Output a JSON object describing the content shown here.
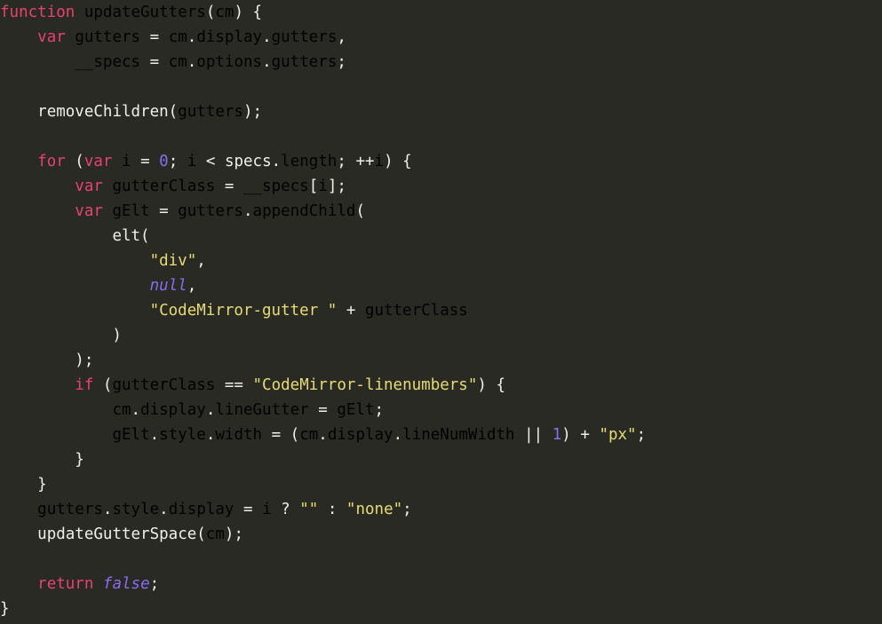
{
  "editor": {
    "background_color": "#2a2a24",
    "language": "javascript",
    "font_size_px": 17.5,
    "line_height_px": 28,
    "colors": {
      "keyword": "#e6436d",
      "definition": "#e8932a",
      "variable": "#79e0d8",
      "property": "#8cc63f",
      "string": "#e6db74",
      "atom": "#8a6cf0",
      "number": "#8a6cf0",
      "plain": "#f0f0e8"
    },
    "code_text": "function updateGutters(cm) {\n    var gutters = cm.display.gutters,\n        __specs = cm.options.gutters;\n\n    removeChildren(gutters);\n\n    for (var i = 0; i < specs.length; ++i) {\n        var gutterClass = __specs[i];\n        var gElt = gutters.appendChild(\n            elt(\n                \"div\",\n                null,\n                \"CodeMirror-gutter \" + gutterClass\n            )\n        );\n        if (gutterClass == \"CodeMirror-linenumbers\") {\n            cm.display.lineGutter = gElt;\n            gElt.style.width = (cm.display.lineNumWidth || 1) + \"px\";\n        }\n    }\n    gutters.style.display = i ? \"\" : \"none\";\n    updateGutterSpace(cm);\n\n    return false;\n}",
    "lines": [
      {
        "n": 1,
        "tokens": [
          {
            "t": "function",
            "c": "keyword"
          },
          {
            "t": " ",
            "c": "plain"
          },
          {
            "t": "updateGutters",
            "c": "definition"
          },
          {
            "t": "(",
            "c": "plain"
          },
          {
            "t": "cm",
            "c": "variable"
          },
          {
            "t": ") {",
            "c": "plain"
          }
        ]
      },
      {
        "n": 2,
        "tokens": [
          {
            "t": "    ",
            "c": "plain"
          },
          {
            "t": "var",
            "c": "keyword"
          },
          {
            "t": " ",
            "c": "plain"
          },
          {
            "t": "gutters",
            "c": "definition"
          },
          {
            "t": " = ",
            "c": "plain"
          },
          {
            "t": "cm",
            "c": "variable"
          },
          {
            "t": ".",
            "c": "plain"
          },
          {
            "t": "display",
            "c": "property"
          },
          {
            "t": ".",
            "c": "plain"
          },
          {
            "t": "gutters",
            "c": "property"
          },
          {
            "t": ",",
            "c": "plain"
          }
        ]
      },
      {
        "n": 3,
        "tokens": [
          {
            "t": "        ",
            "c": "plain"
          },
          {
            "t": "__specs",
            "c": "definition"
          },
          {
            "t": " = ",
            "c": "plain"
          },
          {
            "t": "cm",
            "c": "variable"
          },
          {
            "t": ".",
            "c": "plain"
          },
          {
            "t": "options",
            "c": "property"
          },
          {
            "t": ".",
            "c": "plain"
          },
          {
            "t": "gutters",
            "c": "property"
          },
          {
            "t": ";",
            "c": "plain"
          }
        ]
      },
      {
        "n": 4,
        "tokens": []
      },
      {
        "n": 5,
        "tokens": [
          {
            "t": "    ",
            "c": "plain"
          },
          {
            "t": "removeChildren",
            "c": "plain"
          },
          {
            "t": "(",
            "c": "plain"
          },
          {
            "t": "gutters",
            "c": "variable"
          },
          {
            "t": ");",
            "c": "plain"
          }
        ]
      },
      {
        "n": 6,
        "tokens": []
      },
      {
        "n": 7,
        "tokens": [
          {
            "t": "    ",
            "c": "plain"
          },
          {
            "t": "for",
            "c": "keyword"
          },
          {
            "t": " (",
            "c": "plain"
          },
          {
            "t": "var",
            "c": "keyword"
          },
          {
            "t": " ",
            "c": "plain"
          },
          {
            "t": "i",
            "c": "definition"
          },
          {
            "t": " = ",
            "c": "plain"
          },
          {
            "t": "0",
            "c": "number"
          },
          {
            "t": "; ",
            "c": "plain"
          },
          {
            "t": "i",
            "c": "variable"
          },
          {
            "t": " < ",
            "c": "plain"
          },
          {
            "t": "specs",
            "c": "plain"
          },
          {
            "t": ".",
            "c": "plain"
          },
          {
            "t": "length",
            "c": "property"
          },
          {
            "t": "; ++",
            "c": "plain"
          },
          {
            "t": "i",
            "c": "variable"
          },
          {
            "t": ") {",
            "c": "plain"
          }
        ]
      },
      {
        "n": 8,
        "tokens": [
          {
            "t": "        ",
            "c": "plain"
          },
          {
            "t": "var",
            "c": "keyword"
          },
          {
            "t": " ",
            "c": "plain"
          },
          {
            "t": "gutterClass",
            "c": "definition"
          },
          {
            "t": " = ",
            "c": "plain"
          },
          {
            "t": "__specs",
            "c": "variable"
          },
          {
            "t": "[",
            "c": "plain"
          },
          {
            "t": "i",
            "c": "variable"
          },
          {
            "t": "];",
            "c": "plain"
          }
        ]
      },
      {
        "n": 9,
        "tokens": [
          {
            "t": "        ",
            "c": "plain"
          },
          {
            "t": "var",
            "c": "keyword"
          },
          {
            "t": " ",
            "c": "plain"
          },
          {
            "t": "gElt",
            "c": "definition"
          },
          {
            "t": " = ",
            "c": "plain"
          },
          {
            "t": "gutters",
            "c": "variable"
          },
          {
            "t": ".",
            "c": "plain"
          },
          {
            "t": "appendChild",
            "c": "property"
          },
          {
            "t": "(",
            "c": "plain"
          }
        ]
      },
      {
        "n": 10,
        "tokens": [
          {
            "t": "            ",
            "c": "plain"
          },
          {
            "t": "elt",
            "c": "plain"
          },
          {
            "t": "(",
            "c": "plain"
          }
        ]
      },
      {
        "n": 11,
        "tokens": [
          {
            "t": "                ",
            "c": "plain"
          },
          {
            "t": "\"div\"",
            "c": "string"
          },
          {
            "t": ",",
            "c": "plain"
          }
        ]
      },
      {
        "n": 12,
        "tokens": [
          {
            "t": "                ",
            "c": "plain"
          },
          {
            "t": "null",
            "c": "atom"
          },
          {
            "t": ",",
            "c": "plain"
          }
        ]
      },
      {
        "n": 13,
        "tokens": [
          {
            "t": "                ",
            "c": "plain"
          },
          {
            "t": "\"CodeMirror-gutter \"",
            "c": "string"
          },
          {
            "t": " + ",
            "c": "plain"
          },
          {
            "t": "gutterClass",
            "c": "variable"
          }
        ]
      },
      {
        "n": 14,
        "tokens": [
          {
            "t": "            )",
            "c": "plain"
          }
        ]
      },
      {
        "n": 15,
        "tokens": [
          {
            "t": "        );",
            "c": "plain"
          }
        ]
      },
      {
        "n": 16,
        "tokens": [
          {
            "t": "        ",
            "c": "plain"
          },
          {
            "t": "if",
            "c": "keyword"
          },
          {
            "t": " (",
            "c": "plain"
          },
          {
            "t": "gutterClass",
            "c": "variable"
          },
          {
            "t": " == ",
            "c": "plain"
          },
          {
            "t": "\"CodeMirror-linenumbers\"",
            "c": "string"
          },
          {
            "t": ") {",
            "c": "plain"
          }
        ]
      },
      {
        "n": 17,
        "tokens": [
          {
            "t": "            ",
            "c": "plain"
          },
          {
            "t": "cm",
            "c": "variable"
          },
          {
            "t": ".",
            "c": "plain"
          },
          {
            "t": "display",
            "c": "property"
          },
          {
            "t": ".",
            "c": "plain"
          },
          {
            "t": "lineGutter",
            "c": "property"
          },
          {
            "t": " = ",
            "c": "plain"
          },
          {
            "t": "gElt",
            "c": "variable"
          },
          {
            "t": ";",
            "c": "plain"
          }
        ]
      },
      {
        "n": 18,
        "tokens": [
          {
            "t": "            ",
            "c": "plain"
          },
          {
            "t": "gElt",
            "c": "variable"
          },
          {
            "t": ".",
            "c": "plain"
          },
          {
            "t": "style",
            "c": "property"
          },
          {
            "t": ".",
            "c": "plain"
          },
          {
            "t": "width",
            "c": "property"
          },
          {
            "t": " = (",
            "c": "plain"
          },
          {
            "t": "cm",
            "c": "variable"
          },
          {
            "t": ".",
            "c": "plain"
          },
          {
            "t": "display",
            "c": "property"
          },
          {
            "t": ".",
            "c": "plain"
          },
          {
            "t": "lineNumWidth",
            "c": "property"
          },
          {
            "t": " || ",
            "c": "plain"
          },
          {
            "t": "1",
            "c": "number"
          },
          {
            "t": ") + ",
            "c": "plain"
          },
          {
            "t": "\"px\"",
            "c": "string"
          },
          {
            "t": ";",
            "c": "plain"
          }
        ]
      },
      {
        "n": 19,
        "tokens": [
          {
            "t": "        }",
            "c": "plain"
          }
        ]
      },
      {
        "n": 20,
        "tokens": [
          {
            "t": "    }",
            "c": "plain"
          }
        ]
      },
      {
        "n": 21,
        "tokens": [
          {
            "t": "    ",
            "c": "plain"
          },
          {
            "t": "gutters",
            "c": "variable"
          },
          {
            "t": ".",
            "c": "plain"
          },
          {
            "t": "style",
            "c": "property"
          },
          {
            "t": ".",
            "c": "plain"
          },
          {
            "t": "display",
            "c": "property"
          },
          {
            "t": " = ",
            "c": "plain"
          },
          {
            "t": "i",
            "c": "variable"
          },
          {
            "t": " ? ",
            "c": "plain"
          },
          {
            "t": "\"\"",
            "c": "string"
          },
          {
            "t": " : ",
            "c": "plain"
          },
          {
            "t": "\"none\"",
            "c": "string"
          },
          {
            "t": ";",
            "c": "plain"
          }
        ]
      },
      {
        "n": 22,
        "tokens": [
          {
            "t": "    ",
            "c": "plain"
          },
          {
            "t": "updateGutterSpace",
            "c": "plain"
          },
          {
            "t": "(",
            "c": "plain"
          },
          {
            "t": "cm",
            "c": "variable"
          },
          {
            "t": ");",
            "c": "plain"
          }
        ]
      },
      {
        "n": 23,
        "tokens": []
      },
      {
        "n": 24,
        "tokens": [
          {
            "t": "    ",
            "c": "plain"
          },
          {
            "t": "return",
            "c": "keyword"
          },
          {
            "t": " ",
            "c": "plain"
          },
          {
            "t": "false",
            "c": "atom"
          },
          {
            "t": ";",
            "c": "plain"
          }
        ]
      },
      {
        "n": 25,
        "tokens": [
          {
            "t": "}",
            "c": "plain"
          }
        ]
      }
    ]
  }
}
